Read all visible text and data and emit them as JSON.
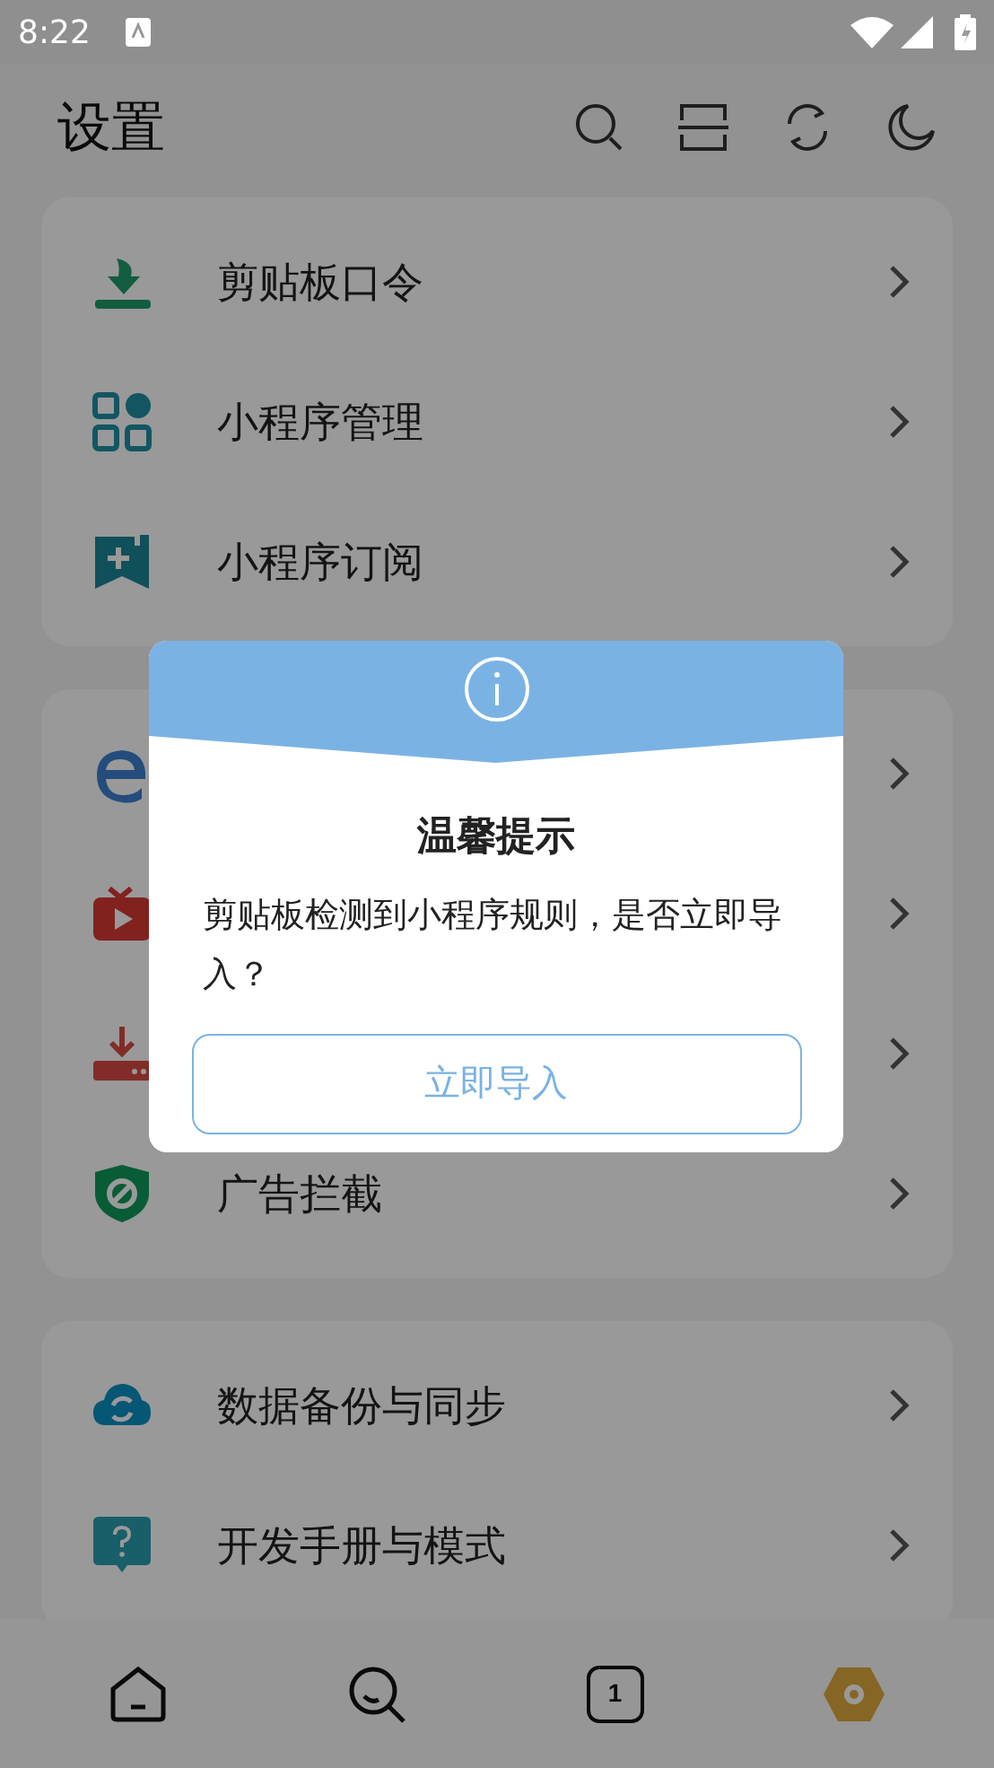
{
  "status_bar": {
    "time": "8:22"
  },
  "header": {
    "title": "设置"
  },
  "groups": [
    {
      "items": [
        {
          "kind": "clipboard",
          "label": "剪贴板口令"
        },
        {
          "kind": "apps",
          "label": "小程序管理"
        },
        {
          "kind": "subscribe",
          "label": "小程序订阅"
        }
      ]
    },
    {
      "items": [
        {
          "kind": "browser"
        },
        {
          "kind": "tv"
        },
        {
          "kind": "download"
        },
        {
          "kind": "shield",
          "label": "广告拦截"
        }
      ]
    },
    {
      "items": [
        {
          "kind": "cloud",
          "label": "数据备份与同步"
        },
        {
          "kind": "help",
          "label": "开发手册与模式"
        }
      ]
    }
  ],
  "bottom_nav": [
    {
      "kind": "home",
      "selected": false
    },
    {
      "kind": "search",
      "selected": false
    },
    {
      "kind": "tabs",
      "count": "1",
      "selected": false
    },
    {
      "kind": "settings",
      "selected": true
    }
  ],
  "dialog": {
    "title": "温馨提示",
    "message": "剪贴板检测到小程序规则，是否立即导入？",
    "button": "立即导入"
  }
}
